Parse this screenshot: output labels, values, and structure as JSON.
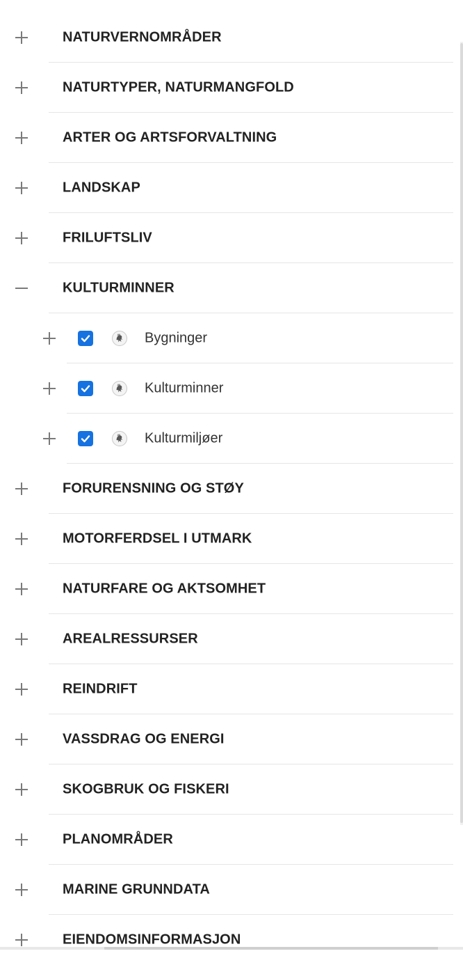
{
  "icons": {
    "expand": "plus-icon",
    "collapse": "minus-icon",
    "checkbox": "check-icon",
    "layer": "coat-of-arms-icon"
  },
  "colors": {
    "checkbox": "#1672e0",
    "text": "#222222",
    "toggle": "#7a7a7a",
    "divider": "#e6e6e6"
  },
  "categories": [
    {
      "label": "NATURVERNOMRÅDER",
      "expanded": false
    },
    {
      "label": "NATURTYPER, NATURMANGFOLD",
      "expanded": false
    },
    {
      "label": "ARTER OG ARTSFORVALTNING",
      "expanded": false
    },
    {
      "label": "LANDSKAP",
      "expanded": false
    },
    {
      "label": "FRILUFTSLIV",
      "expanded": false
    },
    {
      "label": "KULTURMINNER",
      "expanded": true,
      "children": [
        {
          "label": "Bygninger",
          "checked": true
        },
        {
          "label": "Kulturminner",
          "checked": true
        },
        {
          "label": "Kulturmiljøer",
          "checked": true
        }
      ]
    },
    {
      "label": "FORURENSNING OG STØY",
      "expanded": false
    },
    {
      "label": "MOTORFERDSEL I UTMARK",
      "expanded": false
    },
    {
      "label": "NATURFARE OG AKTSOMHET",
      "expanded": false
    },
    {
      "label": "AREALRESSURSER",
      "expanded": false
    },
    {
      "label": "REINDRIFT",
      "expanded": false
    },
    {
      "label": "VASSDRAG OG ENERGI",
      "expanded": false
    },
    {
      "label": "SKOGBRUK OG FISKERI",
      "expanded": false
    },
    {
      "label": "PLANOMRÅDER",
      "expanded": false
    },
    {
      "label": "MARINE GRUNNDATA",
      "expanded": false
    },
    {
      "label": "EIENDOMSINFORMASJON",
      "expanded": false
    }
  ]
}
